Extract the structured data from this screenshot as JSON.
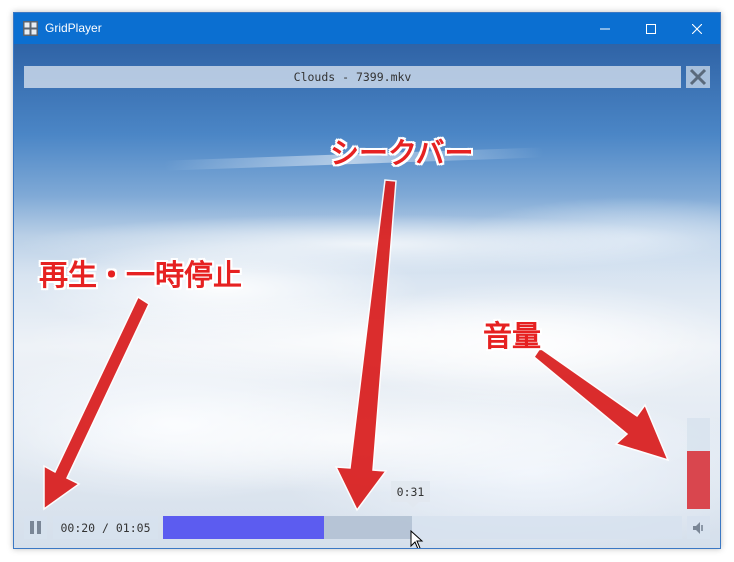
{
  "window": {
    "title": "GridPlayer"
  },
  "player": {
    "filename": "Clouds - 7399.mkv",
    "time_display": "00:20 / 01:05",
    "seek_tooltip": "0:31",
    "progress_fraction": 0.31,
    "hover_fraction": 0.48,
    "volume_fraction": 0.64
  },
  "annotations": {
    "play_pause": "再生・一時停止",
    "seek_bar": "シークバー",
    "volume": "音量"
  },
  "colors": {
    "titlebar": "#0b6fd1",
    "seek_fill": "#5c5cf0",
    "volume_fill": "#d8343c",
    "annotation_text": "#e62121",
    "arrow": "#d91c1c"
  },
  "icons": {
    "app": "app-grid-icon",
    "minimize": "minimize-icon",
    "maximize": "maximize-icon",
    "close": "close-icon",
    "video_close": "close-icon",
    "pause": "pause-icon",
    "mute": "speaker-icon"
  }
}
